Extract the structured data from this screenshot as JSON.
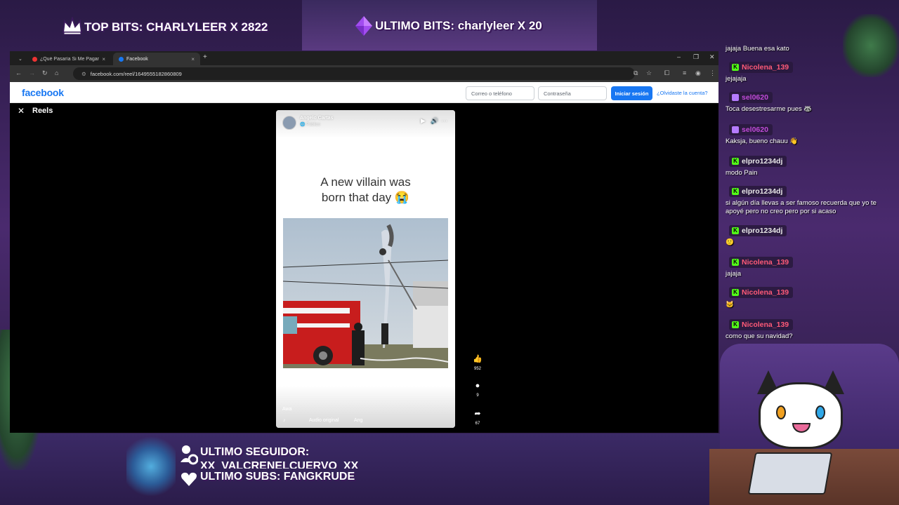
{
  "overlay": {
    "top_bits": "TOP BITS: CHARLYLEER X 2822",
    "ultimo_bits": "ULTIMO BITS: charlyleer X 20",
    "ultimo_seguidor_label": "ULTIMO SEGUIDOR:",
    "ultimo_seguidor_name": "XX_VALCRENELCUERVO_XX",
    "ultimo_subs": "ULTIMO SUBS: FANGKRUDE"
  },
  "browser": {
    "tabs": [
      {
        "label": "¿Qué Pasaría Si Me Pagaras lo",
        "active": false
      },
      {
        "label": "Facebook",
        "active": true
      }
    ],
    "url": "facebook.com/reel/1649555182860809"
  },
  "facebook": {
    "logo": "facebook",
    "email_placeholder": "Correo o teléfono",
    "password_placeholder": "Contraseña",
    "login_button": "Iniciar sesión",
    "forgot_link": "¿Olvidaste la cuenta?",
    "reels_title": "Reels",
    "reel": {
      "author": "Angelo Cartas",
      "visibility": "Público",
      "caption_line1": "A new villain was",
      "caption_line2": "born that day 😭",
      "description": "Awa",
      "audio": "Audio original",
      "audio_author": "Ang",
      "likes": "952",
      "comments": "9",
      "shares": "67"
    }
  },
  "chat": [
    {
      "user": "",
      "text": "jajaja Buena esa kato"
    },
    {
      "user": "Nicolena_139",
      "color": "#ff5a78",
      "badge": "K",
      "badge_color": "#53fc18",
      "text": "jejajaja"
    },
    {
      "user": "sel0620",
      "color": "#c04ad8",
      "badge": "▪",
      "badge_color": "#b57bff",
      "text": "Toca desestresarme pues 🦝"
    },
    {
      "user": "sel0620",
      "color": "#c04ad8",
      "badge": "▪",
      "badge_color": "#b57bff",
      "text": "Kaksja, bueno chauu 👋"
    },
    {
      "user": "elpro1234dj",
      "color": "#e8e8e8",
      "badge": "K",
      "badge_color": "#53fc18",
      "text": "modo Pain"
    },
    {
      "user": "elpro1234dj",
      "color": "#e8e8e8",
      "badge": "K",
      "badge_color": "#53fc18",
      "text": "si algún día llevas a ser famoso recuerda que yo te apoyé pero no creo pero por si acaso"
    },
    {
      "user": "elpro1234dj",
      "color": "#e8e8e8",
      "badge": "K",
      "badge_color": "#53fc18",
      "text": "🙂"
    },
    {
      "user": "Nicolena_139",
      "color": "#ff5a78",
      "badge": "K",
      "badge_color": "#53fc18",
      "text": "jajaja"
    },
    {
      "user": "Nicolena_139",
      "color": "#ff5a78",
      "badge": "K",
      "badge_color": "#53fc18",
      "text": "🐱"
    },
    {
      "user": "Nicolena_139",
      "color": "#ff5a78",
      "badge": "K",
      "badge_color": "#53fc18",
      "text": "como que su navidad?"
    }
  ]
}
